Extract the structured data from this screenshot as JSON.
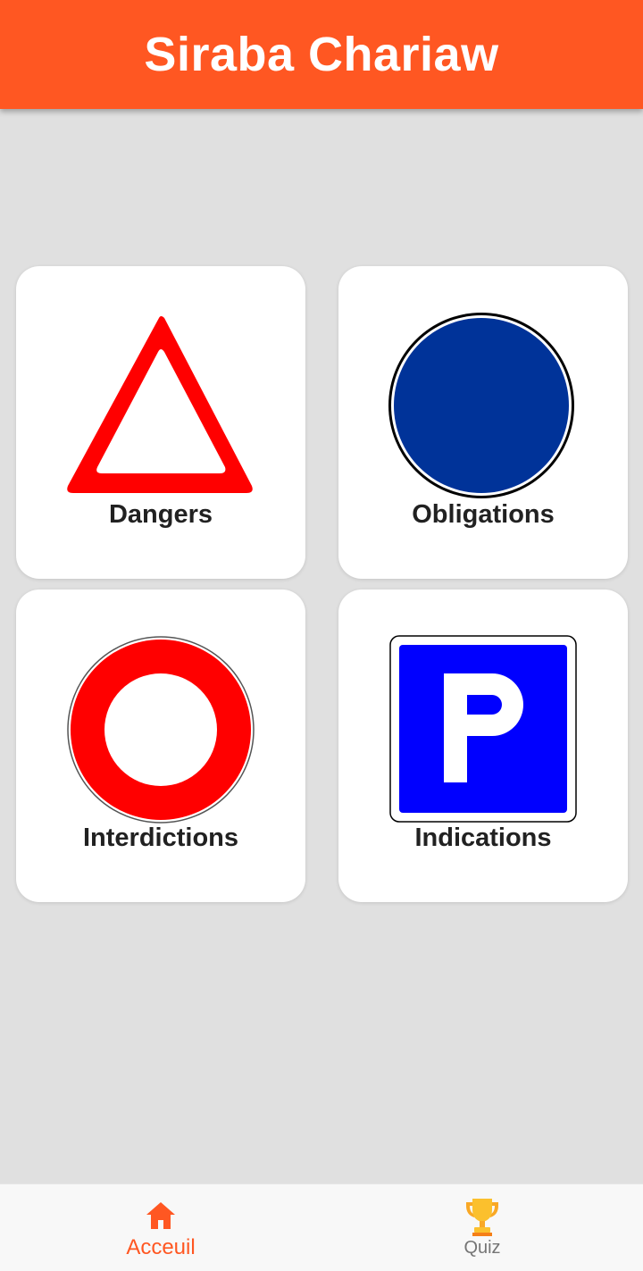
{
  "app_bar": {
    "title": "Siraba Chariaw"
  },
  "categories": [
    {
      "label": "Dangers",
      "icon": "warning-triangle-sign-icon"
    },
    {
      "label": "Obligations",
      "icon": "blue-circle-sign-icon"
    },
    {
      "label": "Interdictions",
      "icon": "prohibition-circle-sign-icon"
    },
    {
      "label": "Indications",
      "icon": "parking-sign-icon"
    }
  ],
  "bottom_nav": {
    "items": [
      {
        "label": "Acceuil",
        "icon": "home-icon",
        "active": true
      },
      {
        "label": "Quiz",
        "icon": "trophy-icon",
        "active": false
      }
    ]
  },
  "colors": {
    "primary": "#ff5722",
    "background": "#e0e0e0",
    "danger_red": "#ff0000",
    "obligation_blue": "#003399",
    "indication_blue": "#0000ff"
  }
}
